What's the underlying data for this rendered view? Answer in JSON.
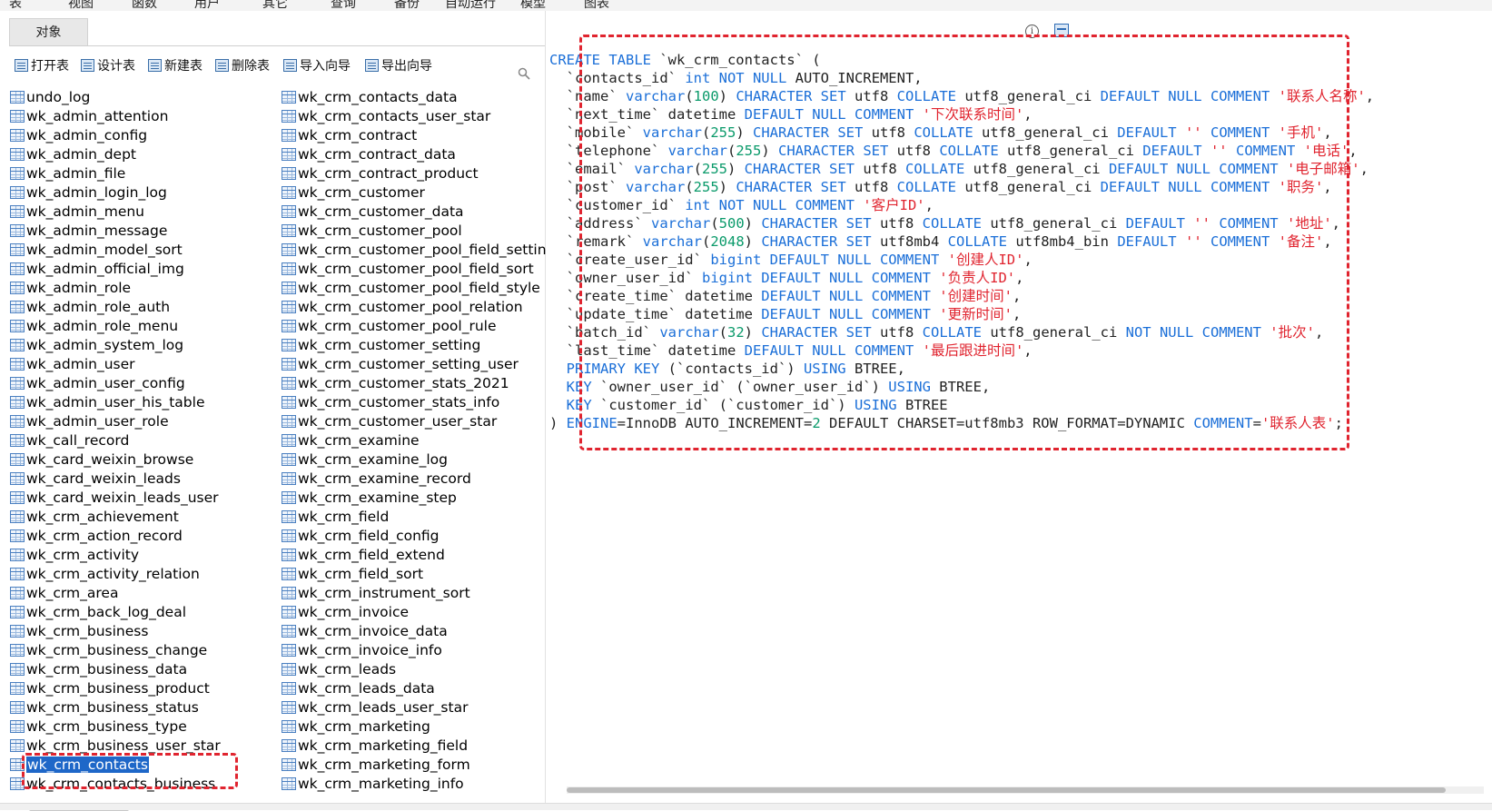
{
  "menu": {
    "items": [
      "表",
      "视图",
      "函数",
      "用户",
      "其它",
      "查询",
      "备份",
      "自动运行",
      "模型",
      "图表"
    ]
  },
  "tab": {
    "label": "对象"
  },
  "toolbar": {
    "open_label": "打开表",
    "design_label": "设计表",
    "new_label": "新建表",
    "delete_label": "删除表",
    "import_label": "导入向导",
    "export_label": "导出向导"
  },
  "tables": {
    "col1": [
      "undo_log",
      "wk_admin_attention",
      "wk_admin_config",
      "wk_admin_dept",
      "wk_admin_file",
      "wk_admin_login_log",
      "wk_admin_menu",
      "wk_admin_message",
      "wk_admin_model_sort",
      "wk_admin_official_img",
      "wk_admin_role",
      "wk_admin_role_auth",
      "wk_admin_role_menu",
      "wk_admin_system_log",
      "wk_admin_user",
      "wk_admin_user_config",
      "wk_admin_user_his_table",
      "wk_admin_user_role",
      "wk_call_record",
      "wk_card_weixin_browse",
      "wk_card_weixin_leads",
      "wk_card_weixin_leads_user",
      "wk_crm_achievement",
      "wk_crm_action_record",
      "wk_crm_activity",
      "wk_crm_activity_relation",
      "wk_crm_area",
      "wk_crm_back_log_deal",
      "wk_crm_business",
      "wk_crm_business_change",
      "wk_crm_business_data",
      "wk_crm_business_product",
      "wk_crm_business_status",
      "wk_crm_business_type",
      "wk_crm_business_user_star",
      "wk_crm_contacts",
      "wk_crm_contacts_business"
    ],
    "col2": [
      "wk_crm_contacts_data",
      "wk_crm_contacts_user_star",
      "wk_crm_contract",
      "wk_crm_contract_data",
      "wk_crm_contract_product",
      "wk_crm_customer",
      "wk_crm_customer_data",
      "wk_crm_customer_pool",
      "wk_crm_customer_pool_field_setting",
      "wk_crm_customer_pool_field_sort",
      "wk_crm_customer_pool_field_style",
      "wk_crm_customer_pool_relation",
      "wk_crm_customer_pool_rule",
      "wk_crm_customer_setting",
      "wk_crm_customer_setting_user",
      "wk_crm_customer_stats_2021",
      "wk_crm_customer_stats_info",
      "wk_crm_customer_user_star",
      "wk_crm_examine",
      "wk_crm_examine_log",
      "wk_crm_examine_record",
      "wk_crm_examine_step",
      "wk_crm_field",
      "wk_crm_field_config",
      "wk_crm_field_extend",
      "wk_crm_field_sort",
      "wk_crm_instrument_sort",
      "wk_crm_invoice",
      "wk_crm_invoice_data",
      "wk_crm_invoice_info",
      "wk_crm_leads",
      "wk_crm_leads_data",
      "wk_crm_leads_user_star",
      "wk_crm_marketing",
      "wk_crm_marketing_field",
      "wk_crm_marketing_form",
      "wk_crm_marketing_info"
    ],
    "selected": "wk_crm_contacts"
  },
  "ddl": {
    "lines": [
      [
        [
          "kw",
          "CREATE TABLE"
        ],
        [
          "p",
          " `wk_crm_contacts` ("
        ]
      ],
      [
        [
          "p",
          "  `contacts_id` "
        ],
        [
          "kw",
          "int NOT NULL"
        ],
        [
          "p",
          " AUTO_INCREMENT,"
        ]
      ],
      [
        [
          "p",
          "  `name` "
        ],
        [
          "kw",
          "varchar"
        ],
        [
          "p",
          "("
        ],
        [
          "num",
          "100"
        ],
        [
          "p",
          ") "
        ],
        [
          "kw",
          "CHARACTER SET"
        ],
        [
          "p",
          " utf8 "
        ],
        [
          "kw",
          "COLLATE"
        ],
        [
          "p",
          " utf8_general_ci "
        ],
        [
          "kw",
          "DEFAULT NULL COMMENT"
        ],
        [
          "p",
          " "
        ],
        [
          "str",
          "'联系人名称'"
        ],
        [
          "p",
          ","
        ]
      ],
      [
        [
          "p",
          "  `next_time` datetime "
        ],
        [
          "kw",
          "DEFAULT NULL COMMENT"
        ],
        [
          "p",
          " "
        ],
        [
          "str",
          "'下次联系时间'"
        ],
        [
          "p",
          ","
        ]
      ],
      [
        [
          "p",
          "  `mobile` "
        ],
        [
          "kw",
          "varchar"
        ],
        [
          "p",
          "("
        ],
        [
          "num",
          "255"
        ],
        [
          "p",
          ") "
        ],
        [
          "kw",
          "CHARACTER SET"
        ],
        [
          "p",
          " utf8 "
        ],
        [
          "kw",
          "COLLATE"
        ],
        [
          "p",
          " utf8_general_ci "
        ],
        [
          "kw",
          "DEFAULT"
        ],
        [
          "p",
          " "
        ],
        [
          "str",
          "''"
        ],
        [
          "p",
          " "
        ],
        [
          "kw",
          "COMMENT"
        ],
        [
          "p",
          " "
        ],
        [
          "str",
          "'手机'"
        ],
        [
          "p",
          ","
        ]
      ],
      [
        [
          "p",
          "  `telephone` "
        ],
        [
          "kw",
          "varchar"
        ],
        [
          "p",
          "("
        ],
        [
          "num",
          "255"
        ],
        [
          "p",
          ") "
        ],
        [
          "kw",
          "CHARACTER SET"
        ],
        [
          "p",
          " utf8 "
        ],
        [
          "kw",
          "COLLATE"
        ],
        [
          "p",
          " utf8_general_ci "
        ],
        [
          "kw",
          "DEFAULT"
        ],
        [
          "p",
          " "
        ],
        [
          "str",
          "''"
        ],
        [
          "p",
          " "
        ],
        [
          "kw",
          "COMMENT"
        ],
        [
          "p",
          " "
        ],
        [
          "str",
          "'电话'"
        ],
        [
          "p",
          ","
        ]
      ],
      [
        [
          "p",
          "  `email` "
        ],
        [
          "kw",
          "varchar"
        ],
        [
          "p",
          "("
        ],
        [
          "num",
          "255"
        ],
        [
          "p",
          ") "
        ],
        [
          "kw",
          "CHARACTER SET"
        ],
        [
          "p",
          " utf8 "
        ],
        [
          "kw",
          "COLLATE"
        ],
        [
          "p",
          " utf8_general_ci "
        ],
        [
          "kw",
          "DEFAULT NULL COMMENT"
        ],
        [
          "p",
          " "
        ],
        [
          "str",
          "'电子邮箱'"
        ],
        [
          "p",
          ","
        ]
      ],
      [
        [
          "p",
          "  `post` "
        ],
        [
          "kw",
          "varchar"
        ],
        [
          "p",
          "("
        ],
        [
          "num",
          "255"
        ],
        [
          "p",
          ") "
        ],
        [
          "kw",
          "CHARACTER SET"
        ],
        [
          "p",
          " utf8 "
        ],
        [
          "kw",
          "COLLATE"
        ],
        [
          "p",
          " utf8_general_ci "
        ],
        [
          "kw",
          "DEFAULT NULL COMMENT"
        ],
        [
          "p",
          " "
        ],
        [
          "str",
          "'职务'"
        ],
        [
          "p",
          ","
        ]
      ],
      [
        [
          "p",
          "  `customer_id` "
        ],
        [
          "kw",
          "int NOT NULL COMMENT"
        ],
        [
          "p",
          " "
        ],
        [
          "str",
          "'客户ID'"
        ],
        [
          "p",
          ","
        ]
      ],
      [
        [
          "p",
          "  `address` "
        ],
        [
          "kw",
          "varchar"
        ],
        [
          "p",
          "("
        ],
        [
          "num",
          "500"
        ],
        [
          "p",
          ") "
        ],
        [
          "kw",
          "CHARACTER SET"
        ],
        [
          "p",
          " utf8 "
        ],
        [
          "kw",
          "COLLATE"
        ],
        [
          "p",
          " utf8_general_ci "
        ],
        [
          "kw",
          "DEFAULT"
        ],
        [
          "p",
          " "
        ],
        [
          "str",
          "''"
        ],
        [
          "p",
          " "
        ],
        [
          "kw",
          "COMMENT"
        ],
        [
          "p",
          " "
        ],
        [
          "str",
          "'地址'"
        ],
        [
          "p",
          ","
        ]
      ],
      [
        [
          "p",
          "  `remark` "
        ],
        [
          "kw",
          "varchar"
        ],
        [
          "p",
          "("
        ],
        [
          "num",
          "2048"
        ],
        [
          "p",
          ") "
        ],
        [
          "kw",
          "CHARACTER SET"
        ],
        [
          "p",
          " utf8mb4 "
        ],
        [
          "kw",
          "COLLATE"
        ],
        [
          "p",
          " utf8mb4_bin "
        ],
        [
          "kw",
          "DEFAULT"
        ],
        [
          "p",
          " "
        ],
        [
          "str",
          "''"
        ],
        [
          "p",
          " "
        ],
        [
          "kw",
          "COMMENT"
        ],
        [
          "p",
          " "
        ],
        [
          "str",
          "'备注'"
        ],
        [
          "p",
          ","
        ]
      ],
      [
        [
          "p",
          "  `create_user_id` "
        ],
        [
          "kw",
          "bigint DEFAULT NULL COMMENT"
        ],
        [
          "p",
          " "
        ],
        [
          "str",
          "'创建人ID'"
        ],
        [
          "p",
          ","
        ]
      ],
      [
        [
          "p",
          "  `owner_user_id` "
        ],
        [
          "kw",
          "bigint DEFAULT NULL COMMENT"
        ],
        [
          "p",
          " "
        ],
        [
          "str",
          "'负责人ID'"
        ],
        [
          "p",
          ","
        ]
      ],
      [
        [
          "p",
          "  `create_time` datetime "
        ],
        [
          "kw",
          "DEFAULT NULL COMMENT"
        ],
        [
          "p",
          " "
        ],
        [
          "str",
          "'创建时间'"
        ],
        [
          "p",
          ","
        ]
      ],
      [
        [
          "p",
          "  `update_time` datetime "
        ],
        [
          "kw",
          "DEFAULT NULL COMMENT"
        ],
        [
          "p",
          " "
        ],
        [
          "str",
          "'更新时间'"
        ],
        [
          "p",
          ","
        ]
      ],
      [
        [
          "p",
          "  `batch_id` "
        ],
        [
          "kw",
          "varchar"
        ],
        [
          "p",
          "("
        ],
        [
          "num",
          "32"
        ],
        [
          "p",
          ") "
        ],
        [
          "kw",
          "CHARACTER SET"
        ],
        [
          "p",
          " utf8 "
        ],
        [
          "kw",
          "COLLATE"
        ],
        [
          "p",
          " utf8_general_ci "
        ],
        [
          "kw",
          "NOT NULL COMMENT"
        ],
        [
          "p",
          " "
        ],
        [
          "str",
          "'批次'"
        ],
        [
          "p",
          ","
        ]
      ],
      [
        [
          "p",
          "  `last_time` datetime "
        ],
        [
          "kw",
          "DEFAULT NULL COMMENT"
        ],
        [
          "p",
          " "
        ],
        [
          "str",
          "'最后跟进时间'"
        ],
        [
          "p",
          ","
        ]
      ],
      [
        [
          "kw",
          "  PRIMARY KEY"
        ],
        [
          "p",
          " (`contacts_id`) "
        ],
        [
          "kw",
          "USING"
        ],
        [
          "p",
          " BTREE,"
        ]
      ],
      [
        [
          "kw",
          "  KEY"
        ],
        [
          "p",
          " `owner_user_id` (`owner_user_id`) "
        ],
        [
          "kw",
          "USING"
        ],
        [
          "p",
          " BTREE,"
        ]
      ],
      [
        [
          "kw",
          "  KEY"
        ],
        [
          "p",
          " `customer_id` (`customer_id`) "
        ],
        [
          "kw",
          "USING"
        ],
        [
          "p",
          " BTREE"
        ]
      ],
      [
        [
          "p",
          ") "
        ],
        [
          "kw",
          "ENGINE"
        ],
        [
          "p",
          "=InnoDB AUTO_INCREMENT="
        ],
        [
          "num",
          "2"
        ],
        [
          "p",
          " DEFAULT CHARSET=utf8mb3 ROW_FORMAT=DYNAMIC "
        ],
        [
          "kw",
          "COMMENT"
        ],
        [
          "p",
          "="
        ],
        [
          "str",
          "'联系人表'"
        ],
        [
          "p",
          ";"
        ]
      ]
    ]
  },
  "colors": {
    "keyword": "#1b6fd8",
    "number": "#0a9a6a",
    "string": "#e0242f",
    "selection": "#1e67c8",
    "highlight": "#e0242f"
  },
  "icons": {
    "info": "info-icon",
    "preview": "preview-icon",
    "search": "search-icon",
    "table": "table-icon"
  }
}
